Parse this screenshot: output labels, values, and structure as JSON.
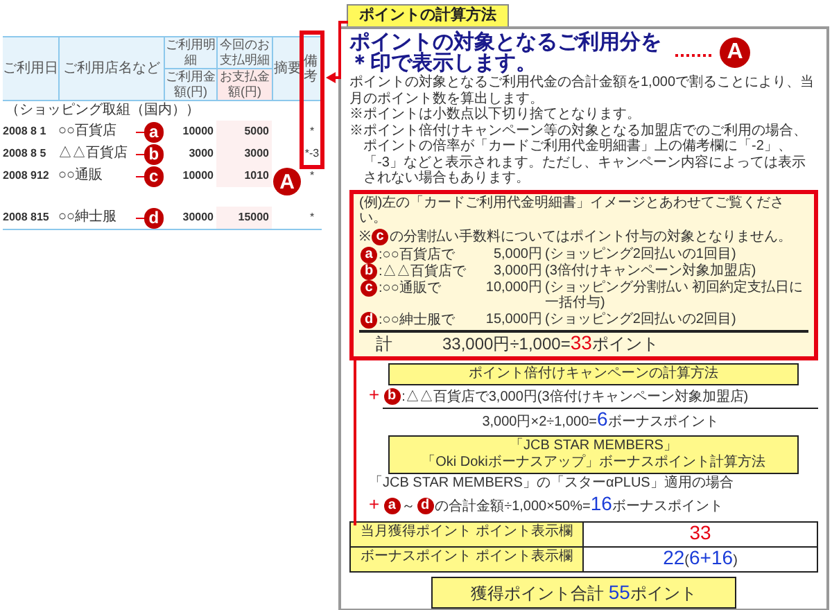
{
  "statement": {
    "group_headers": [
      "ご利用明細",
      "今回のお支払明細"
    ],
    "columns": [
      "ご利用日",
      "ご利用店名など",
      "ご利用金額(円)",
      "お支払金額(円)",
      "摘要",
      "備考"
    ],
    "section_label": "（ショッピング取組（国内））",
    "rows": [
      {
        "date": "2008 8 1",
        "store": "○○百貨店",
        "amount": "10000",
        "payment": "5000",
        "remark": "*",
        "marker": "a"
      },
      {
        "date": "2008 8 5",
        "store": "△△百貨店",
        "amount": "3000",
        "payment": "3000",
        "remark": "*-3",
        "marker": "b"
      },
      {
        "date": "2008 912",
        "store": "○○通販",
        "amount": "10000",
        "payment": "1010",
        "remark": "*",
        "marker": "c"
      },
      {
        "date": "2008 815",
        "store": "○○紳士服",
        "amount": "30000",
        "payment": "15000",
        "remark": "*",
        "marker": "d"
      }
    ],
    "callout": "A"
  },
  "panel": {
    "tab": "ポイントの計算方法",
    "headline": [
      "ポイントの対象となるご利用分を",
      "＊印で表示します。"
    ],
    "headline_marker": "A",
    "intro": "ポイントの対象となるご利用代金の合計金額を1,000で割ることにより、当月のポイント数を算出します。",
    "notes": [
      "※ポイントは小数点以下切り捨てとなります。",
      "※ポイント倍付けキャンペーン等の対象となる加盟店でのご利用の場合、ポイントの倍率が「カードご利用代金明細書」上の備考欄に「-2」、「-3」などと表示されます。ただし、キャンペーン内容によっては表示されない場合もあります。"
    ],
    "example": {
      "intro": "(例)左の「カードご利用代金明細書」イメージとあわせてご覧ください。",
      "note": [
        {
          "kind": "text",
          "text": "※"
        },
        {
          "kind": "marker",
          "text": "c"
        },
        {
          "kind": "text",
          "text": "の分割払い手数料についてはポイント付与の対象となりません。"
        }
      ],
      "items": [
        {
          "marker": "a",
          "store": ":○○百貨店で",
          "amount": "5,000円",
          "detail": "(ショッピング2回払いの1回目)"
        },
        {
          "marker": "b",
          "store": ":△△百貨店で",
          "amount": "3,000円",
          "detail": "(3倍付けキャンペーン対象加盟店)"
        },
        {
          "marker": "c",
          "store": ":○○通販で",
          "amount": "10,000円",
          "detail": "(ショッピング分割払い 初回約定支払日に一括付与)"
        },
        {
          "marker": "d",
          "store": ":○○紳士服で",
          "amount": "15,000円",
          "detail": "(ショッピング2回払いの2回目)"
        }
      ],
      "total_label": "計",
      "total": [
        {
          "kind": "text",
          "text": "33,000円÷1,000="
        },
        {
          "kind": "red",
          "text": "33"
        },
        {
          "kind": "text",
          "text": "ポイント"
        }
      ]
    },
    "campaign": {
      "heading": [
        "ポイント倍付けキャンペーンの計算方法"
      ],
      "lines": [
        [
          {
            "kind": "plus",
            "text": "+"
          },
          {
            "kind": "marker",
            "text": "b"
          },
          {
            "kind": "text",
            "text": ":△△百貨店で3,000円(3倍付けキャンペーン対象加盟店)"
          }
        ],
        [
          {
            "kind": "text",
            "text": "3,000円×2÷1,000="
          },
          {
            "kind": "blue",
            "text": "6"
          },
          {
            "kind": "text",
            "text": "ボーナスポイント"
          }
        ]
      ]
    },
    "jcb": {
      "heading": [
        "「JCB STAR MEMBERS」",
        "「Oki Dokiボーナスアップ」ボーナスポイント計算方法"
      ],
      "lines": [
        [
          {
            "kind": "text",
            "text": "「JCB STAR MEMBERS」の「スターαPLUS」適用の場合"
          }
        ],
        [
          {
            "kind": "plus",
            "text": "+"
          },
          {
            "kind": "marker",
            "text": "a"
          },
          {
            "kind": "text",
            "text": "～"
          },
          {
            "kind": "marker",
            "text": "d"
          },
          {
            "kind": "text",
            "text": "の合計金額÷1,000×50%="
          },
          {
            "kind": "blue",
            "text": "16"
          },
          {
            "kind": "text",
            "text": "ボーナスポイント"
          }
        ]
      ]
    },
    "summary": [
      {
        "label": "当月獲得ポイント ポイント表示欄",
        "value": [
          {
            "kind": "red",
            "text": "33"
          }
        ]
      },
      {
        "label": "ボーナスポイント ポイント表示欄",
        "value": [
          {
            "kind": "blue",
            "text": "22"
          },
          {
            "kind": "text",
            "text": "("
          },
          {
            "kind": "blue",
            "text": "6+16"
          },
          {
            "kind": "text",
            "text": ")"
          }
        ]
      }
    ],
    "grand_total": [
      {
        "kind": "text",
        "text": "獲得ポイント合計 "
      },
      {
        "kind": "blue",
        "text": "55"
      },
      {
        "kind": "text",
        "text": "ポイント"
      }
    ]
  }
}
